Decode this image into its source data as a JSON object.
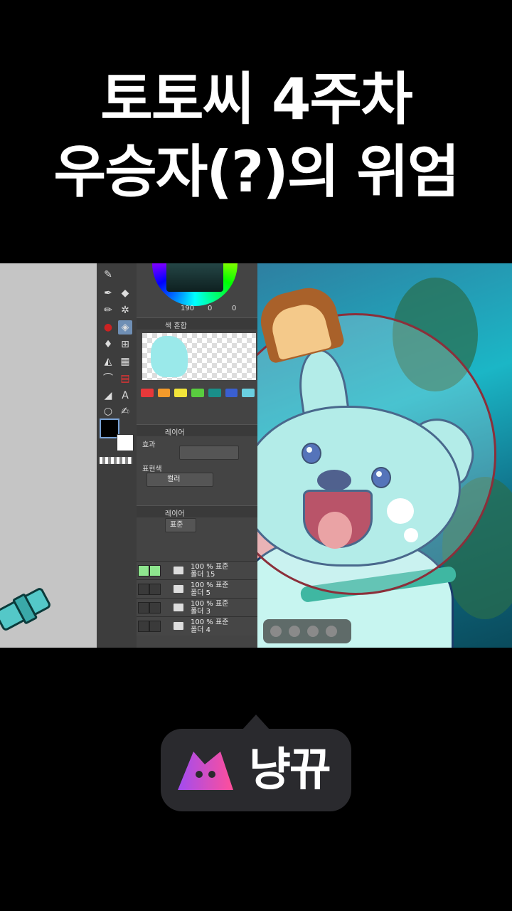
{
  "headline": {
    "line1": "토토씨 4주차",
    "line2": "우승자(?)의 위엄"
  },
  "app_panel": {
    "brush_size": "190",
    "opacity": "0",
    "value": "0",
    "color_mix_tab": "색 혼합",
    "layer_tab": "레이어",
    "effect_label": "효과",
    "expression_color_label": "표현색",
    "color_mode": "컬러",
    "layer_panel_tab": "레이어",
    "blend_mode": "표준",
    "palette_colors": [
      "#e8383a",
      "#f39a2b",
      "#f2e43a",
      "#59cc3f",
      "#1a8f8a",
      "#3a5fd0",
      "#6ad0e0"
    ],
    "layers": [
      {
        "opacity_mode": "100 % 표준",
        "name": "폴더 15",
        "visible": true
      },
      {
        "opacity_mode": "100 % 표준",
        "name": "폴더 5",
        "visible": false
      },
      {
        "opacity_mode": "100 % 표준",
        "name": "폴더 3",
        "visible": false
      },
      {
        "opacity_mode": "100 % 표준",
        "name": "폴더 4",
        "visible": false
      }
    ]
  },
  "brand": {
    "name": "냥뀨",
    "logo_color_start": "#a14cf0",
    "logo_color_end": "#ff4f9a"
  }
}
